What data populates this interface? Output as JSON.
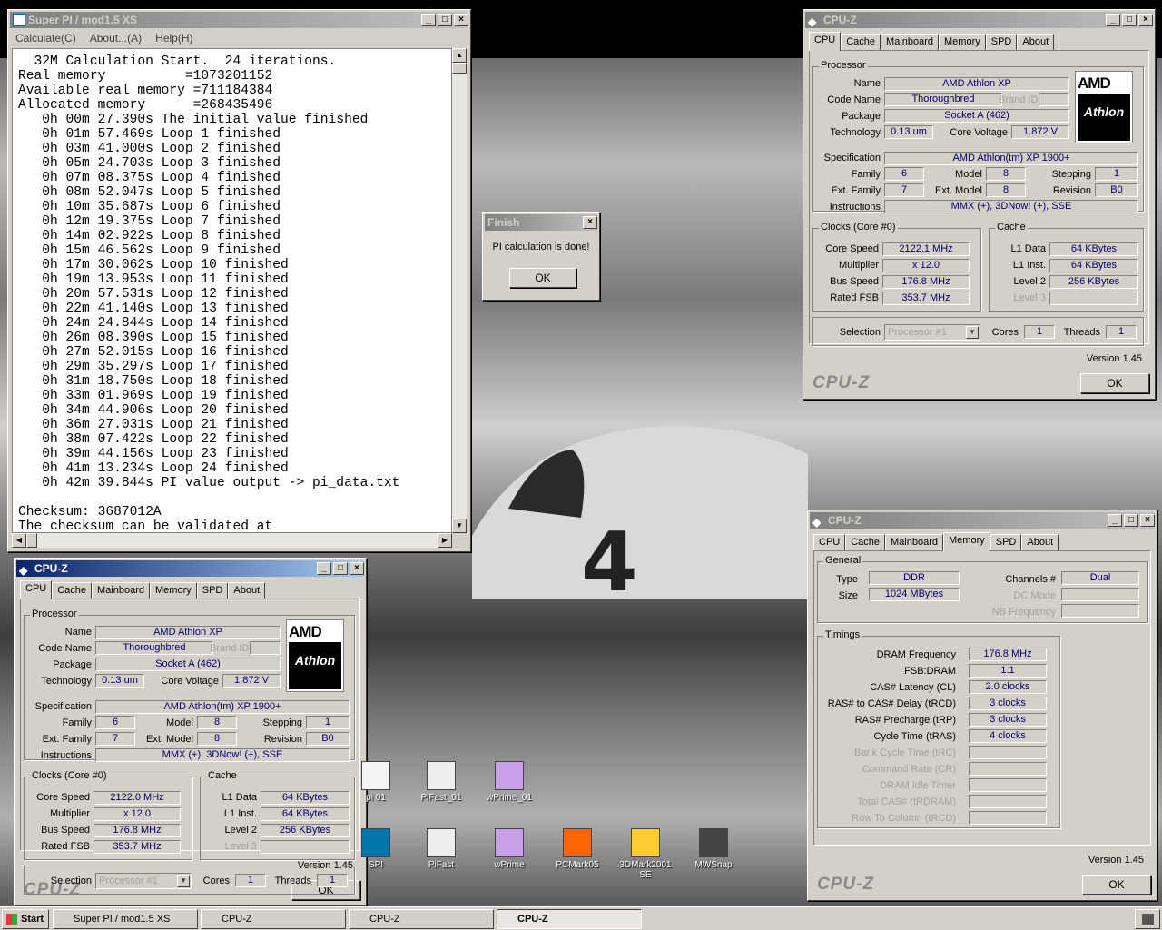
{
  "superpi": {
    "title": "Super PI / mod1.5 XS",
    "menu": [
      "Calculate(C)",
      "About...(A)",
      "Help(H)"
    ],
    "log": [
      "  32M Calculation Start.  24 iterations.",
      "Real memory          =1073201152",
      "Available real memory =711184384",
      "Allocated memory      =268435496",
      "   0h 00m 27.390s The initial value finished",
      "   0h 01m 57.469s Loop 1 finished",
      "   0h 03m 41.000s Loop 2 finished",
      "   0h 05m 24.703s Loop 3 finished",
      "   0h 07m 08.375s Loop 4 finished",
      "   0h 08m 52.047s Loop 5 finished",
      "   0h 10m 35.687s Loop 6 finished",
      "   0h 12m 19.375s Loop 7 finished",
      "   0h 14m 02.922s Loop 8 finished",
      "   0h 15m 46.562s Loop 9 finished",
      "   0h 17m 30.062s Loop 10 finished",
      "   0h 19m 13.953s Loop 11 finished",
      "   0h 20m 57.531s Loop 12 finished",
      "   0h 22m 41.140s Loop 13 finished",
      "   0h 24m 24.844s Loop 14 finished",
      "   0h 26m 08.390s Loop 15 finished",
      "   0h 27m 52.015s Loop 16 finished",
      "   0h 29m 35.297s Loop 17 finished",
      "   0h 31m 18.750s Loop 18 finished",
      "   0h 33m 01.969s Loop 19 finished",
      "   0h 34m 44.906s Loop 20 finished",
      "   0h 36m 27.031s Loop 21 finished",
      "   0h 38m 07.422s Loop 22 finished",
      "   0h 39m 44.156s Loop 23 finished",
      "   0h 41m 13.234s Loop 24 finished",
      "   0h 42m 39.844s PI value output -> pi_data.txt",
      "",
      "Checksum: 3687012A",
      "The checksum can be validated at"
    ]
  },
  "finish": {
    "title": "Finish",
    "message": "PI calculation is done!",
    "ok": "OK"
  },
  "cpuz_tabs": [
    "CPU",
    "Cache",
    "Mainboard",
    "Memory",
    "SPD",
    "About"
  ],
  "cpu": {
    "title": "CPU-Z",
    "processor_label": "Processor",
    "name_label": "Name",
    "name": "AMD Athlon XP",
    "codename_label": "Code Name",
    "codename": "Thoroughbred",
    "brandid_label": "Brand ID",
    "package_label": "Package",
    "package": "Socket A (462)",
    "tech_label": "Technology",
    "tech": "0.13 um",
    "voltage_label": "Core Voltage",
    "voltage": "1.872 V",
    "spec_label": "Specification",
    "spec": "AMD Athlon(tm) XP 1900+",
    "family_label": "Family",
    "family": "6",
    "model_label": "Model",
    "model": "8",
    "stepping_label": "Stepping",
    "stepping": "1",
    "extfamily_label": "Ext. Family",
    "extfamily": "7",
    "extmodel_label": "Ext. Model",
    "extmodel": "8",
    "revision_label": "Revision",
    "revision": "B0",
    "instr_label": "Instructions",
    "instr": "MMX (+), 3DNow! (+), SSE",
    "clocks_label": "Clocks (Core #0)",
    "corespeed_label": "Core Speed",
    "multiplier_label": "Multiplier",
    "multiplier": "x 12.0",
    "busspeed_label": "Bus Speed",
    "busspeed": "176.8 MHz",
    "ratedfsb_label": "Rated FSB",
    "ratedfsb": "353.7 MHz",
    "cache_label": "Cache",
    "l1d_label": "L1 Data",
    "l1d": "64 KBytes",
    "l1i_label": "L1 Inst.",
    "l1i": "64 KBytes",
    "l2_label": "Level 2",
    "l2": "256 KBytes",
    "l3_label": "Level 3",
    "selection_label": "Selection",
    "selection": "Processor #1",
    "cores_label": "Cores",
    "cores": "1",
    "threads_label": "Threads",
    "threads": "1",
    "version": "Version 1.45",
    "brand": "CPU-Z",
    "ok": "OK",
    "logo_amd": "AMD",
    "logo_athlon": "Athlon",
    "logo_xp": "XP",
    "corespeed_top": "2122.1 MHz",
    "corespeed_bottom": "2122.0 MHz"
  },
  "mem": {
    "general_label": "General",
    "type_label": "Type",
    "type": "DDR",
    "size_label": "Size",
    "size": "1024 MBytes",
    "channels_label": "Channels #",
    "channels": "Dual",
    "dcmode_label": "DC Mode",
    "nbfreq_label": "NB Frequency",
    "timings_label": "Timings",
    "dramfreq_label": "DRAM Frequency",
    "dramfreq": "176.8 MHz",
    "fsbdram_label": "FSB:DRAM",
    "fsbdram": "1:1",
    "cas_label": "CAS# Latency (CL)",
    "cas": "2.0 clocks",
    "trcd_label": "RAS# to CAS# Delay (tRCD)",
    "trcd": "3 clocks",
    "trp_label": "RAS# Precharge (tRP)",
    "trp": "3 clocks",
    "tras_label": "Cycle Time (tRAS)",
    "tras": "4 clocks",
    "trc_label": "Bank Cycle Time (tRC)",
    "cr_label": "Command Rate (CR)",
    "idle_label": "DRAM Idle Timer",
    "trdram_label": "Total CAS# (tRDRAM)",
    "rtc_label": "Row To Column (tRCD)"
  },
  "desktop": [
    {
      "label": "pi 01"
    },
    {
      "label": "PiFast_01"
    },
    {
      "label": "wPrime_01"
    },
    {
      "label": "SPI"
    },
    {
      "label": "PiFast"
    },
    {
      "label": "wPrime"
    },
    {
      "label": "PCMark05"
    },
    {
      "label": "3DMark2001 SE"
    },
    {
      "label": "MWSnap"
    }
  ],
  "taskbar": {
    "start": "Start",
    "items": [
      "Super PI / mod1.5 XS",
      "CPU-Z",
      "CPU-Z",
      "CPU-Z"
    ]
  },
  "colors": {
    "titlebar_active": "#0a246a",
    "value_text": "#00006e",
    "face": "#d4d0c8"
  }
}
